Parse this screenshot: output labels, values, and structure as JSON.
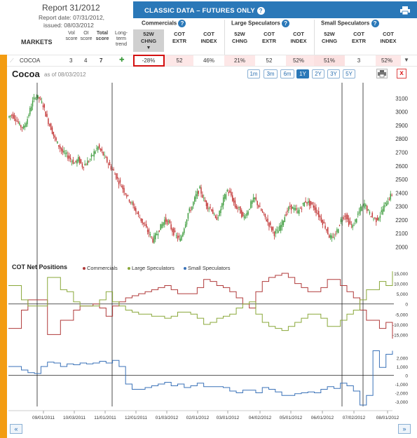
{
  "report": {
    "title": "Report 31/2012",
    "date_line": "Report date: 07/31/2012,",
    "issued_line": "issued: 08/03/2012"
  },
  "left_columns": {
    "markets": "MARKETS",
    "vol": [
      "Vol",
      "score"
    ],
    "oi": [
      "OI",
      "score"
    ],
    "total": [
      "Total",
      "score"
    ],
    "trend": [
      "Long-term",
      "trend"
    ]
  },
  "banner": {
    "title": "CLASSIC DATA – FUTURES ONLY",
    "help": "?"
  },
  "groups": {
    "commercials": "Commercials",
    "large": "Large Speculators",
    "small": "Small Speculators"
  },
  "subcols": [
    [
      "52W",
      "CHNG"
    ],
    [
      "COT",
      "EXTR"
    ],
    [
      "COT",
      "INDEX"
    ],
    [
      "52W",
      "CHNG"
    ],
    [
      "COT",
      "EXTR"
    ],
    [
      "COT",
      "INDEX"
    ],
    [
      "52W",
      "CHNG"
    ],
    [
      "COT",
      "EXTR"
    ],
    [
      "COT",
      "INDEX"
    ]
  ],
  "row": {
    "market": "COCOA",
    "vol": "3",
    "oi": "4",
    "total": "7",
    "values": [
      "-28%",
      "52",
      "46%",
      "21%",
      "52",
      "52%",
      "51%",
      "3",
      "52%"
    ]
  },
  "chart": {
    "title": "Cocoa",
    "as_of": "as of 08/03/2012",
    "ranges": [
      "1m",
      "3m",
      "6m",
      "1Y",
      "2Y",
      "3Y",
      "5Y"
    ],
    "active_range": "1Y",
    "close": "x"
  },
  "cot": {
    "title": "COT Net Positions",
    "legend": [
      "Commercials",
      "Large Speculators",
      "Small Speculators"
    ]
  },
  "colors": {
    "commercials": "#b03a3a",
    "large": "#8aa83a",
    "small": "#3a72b8",
    "up_candle": "#3a9a3a",
    "down_candle": "#c03030",
    "accent": "#2a78b8",
    "orange": "#f39c12"
  },
  "chart_data": [
    {
      "type": "candlestick",
      "title": "Cocoa",
      "x_ticks": [
        "09/01/2011",
        "10/03/2011",
        "11/01/2011",
        "12/01/2011",
        "01/03/2012",
        "02/01/2012",
        "03/01/2012",
        "04/02/2012",
        "05/01/2012",
        "06/01/2012",
        "07/02/2012",
        "08/01/2012"
      ],
      "y_ticks": [
        2000,
        2100,
        2200,
        2300,
        2400,
        2500,
        2600,
        2700,
        2800,
        2900,
        3000,
        3100
      ],
      "ylim": [
        1950,
        3180
      ],
      "close_series": [
        2980,
        2950,
        2900,
        2880,
        2950,
        3050,
        3120,
        3100,
        3050,
        2950,
        2880,
        2800,
        2750,
        2700,
        2680,
        2650,
        2620,
        2650,
        2600,
        2620,
        2650,
        2700,
        2740,
        2700,
        2650,
        2600,
        2560,
        2500,
        2450,
        2400,
        2350,
        2300,
        2250,
        2200,
        2150,
        2100,
        2050,
        2100,
        2150,
        2200,
        2180,
        2120,
        2080,
        2050,
        2150,
        2250,
        2300,
        2380,
        2430,
        2350,
        2300,
        2280,
        2200,
        2250,
        2350,
        2420,
        2380,
        2300,
        2280,
        2220,
        2250,
        2320,
        2360,
        2300,
        2250,
        2200,
        2150,
        2100,
        2120,
        2180,
        2250,
        2300,
        2280,
        2260,
        2300,
        2340,
        2320,
        2300,
        2250,
        2200,
        2150,
        2080,
        2060,
        2120,
        2200,
        2240,
        2180,
        2150,
        2220,
        2280,
        2320,
        2260,
        2220,
        2200,
        2240,
        2300,
        2350,
        2390
      ]
    },
    {
      "type": "line",
      "title": "COT Net Positions",
      "series": [
        {
          "name": "Commercials",
          "values": [
            -12000,
            -12000,
            -3000,
            2000,
            2000,
            2000,
            -15000,
            -15000,
            -8000,
            -8000,
            -3000,
            -1000,
            -1000,
            0,
            -2000,
            -6000,
            -1000,
            1000,
            3000,
            4000,
            5000,
            6000,
            7000,
            8000,
            9000,
            7000,
            5000,
            5000,
            5000,
            8000,
            12000,
            11000,
            9000,
            8000,
            6000,
            3000,
            0,
            -2000,
            6000,
            11000,
            13000,
            14000,
            15000,
            13000,
            10000,
            8000,
            6000,
            6000,
            8000,
            12000,
            12000,
            9000,
            6000,
            3000,
            -3000,
            -8000,
            -8000,
            -12000,
            -9000,
            -17000
          ]
        },
        {
          "name": "Large Speculators",
          "values": [
            9000,
            9000,
            2000,
            -1000,
            -1000,
            -1000,
            13000,
            13000,
            7000,
            6000,
            1000,
            -1000,
            -1000,
            -1000,
            2000,
            6000,
            1000,
            -1000,
            -3000,
            -4000,
            -5000,
            -5000,
            -6000,
            -6000,
            -7000,
            -6000,
            -4000,
            -4000,
            -5000,
            -7000,
            -10000,
            -9000,
            -7000,
            -6000,
            -5000,
            -2000,
            0,
            1000,
            -5000,
            -9000,
            -11000,
            -12000,
            -13000,
            -11000,
            -9000,
            -7000,
            -5000,
            -5000,
            -7000,
            -11000,
            -11000,
            -8000,
            -5000,
            -3000,
            2000,
            7000,
            7000,
            11000,
            9000,
            16000
          ]
        },
        {
          "name": "Small Speculators",
          "values": [
            1000,
            1000,
            600,
            300,
            200,
            1000,
            1500,
            1400,
            1000,
            1300,
            1200,
            1400,
            1300,
            1400,
            1600,
            1400,
            1700,
            1000,
            -1000,
            -1600,
            -1600,
            -1400,
            -1200,
            -1000,
            -800,
            -1200,
            -1000,
            -1400,
            -1200,
            -900,
            -1300,
            -1300,
            -1300,
            -1400,
            -1800,
            -2000,
            -1700,
            -1700,
            -2000,
            -1400,
            -1600,
            -1900,
            -2300,
            -2300,
            -2100,
            -2000,
            -1900,
            -2000,
            -1600,
            -1300,
            -1500,
            -900,
            -1200,
            -1800,
            -3400,
            -2300,
            2800,
            900,
            2400,
            2800
          ]
        }
      ],
      "y_ticks_top": [
        15000,
        10000,
        5000,
        0,
        -5000,
        -10000,
        -15000
      ],
      "y_ticks_bottom": [
        2000,
        1000,
        0,
        -1000,
        -2000,
        -3000
      ]
    }
  ]
}
